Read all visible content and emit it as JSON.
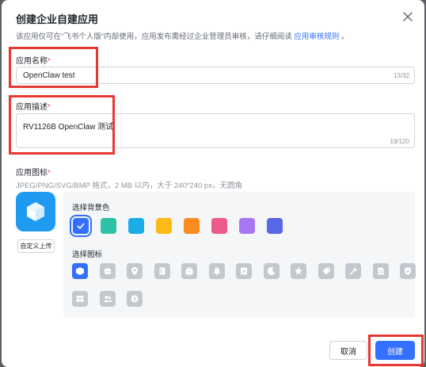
{
  "dialog": {
    "title": "创建企业自建应用",
    "subtitle_text": "该应用仅可在\"飞书个人版\"内部使用，应用发布需经过企业管理员审核，请仔细阅读",
    "subtitle_link": "应用审核规则",
    "subtitle_suffix": "。"
  },
  "form": {
    "name_label": "应用名称",
    "name_value": "OpenClaw test",
    "name_count": "13/32",
    "desc_label": "应用描述",
    "desc_value": "RV1126B OpenClaw 测试",
    "desc_count": "19/120",
    "icon_label": "应用图标",
    "required_mark": "*",
    "icon_hint": "JPEG/PNG/SVG/BMP 格式，2 MB 以内，大于 240*240 px，无圆角",
    "upload_label": "自定义上传"
  },
  "picker": {
    "bg_title": "选择背景色",
    "icon_title": "选择图标",
    "colors": [
      "#3370ff",
      "#2cc2a6",
      "#1aade8",
      "#fabb17",
      "#fc8c1e",
      "#ec5a8a",
      "#a876f2",
      "#5a67e8"
    ],
    "icons": [
      "cube-icon",
      "robot-icon",
      "location-pin-icon",
      "book-icon",
      "briefcase-icon",
      "bell-icon",
      "checklist-icon",
      "moon-icon",
      "star-icon",
      "tag-icon",
      "wrench-icon",
      "document-icon",
      "shield-check-icon",
      "layout-icon",
      "users-icon",
      "compass-icon"
    ]
  },
  "footer": {
    "cancel_label": "取消",
    "create_label": "创建"
  }
}
